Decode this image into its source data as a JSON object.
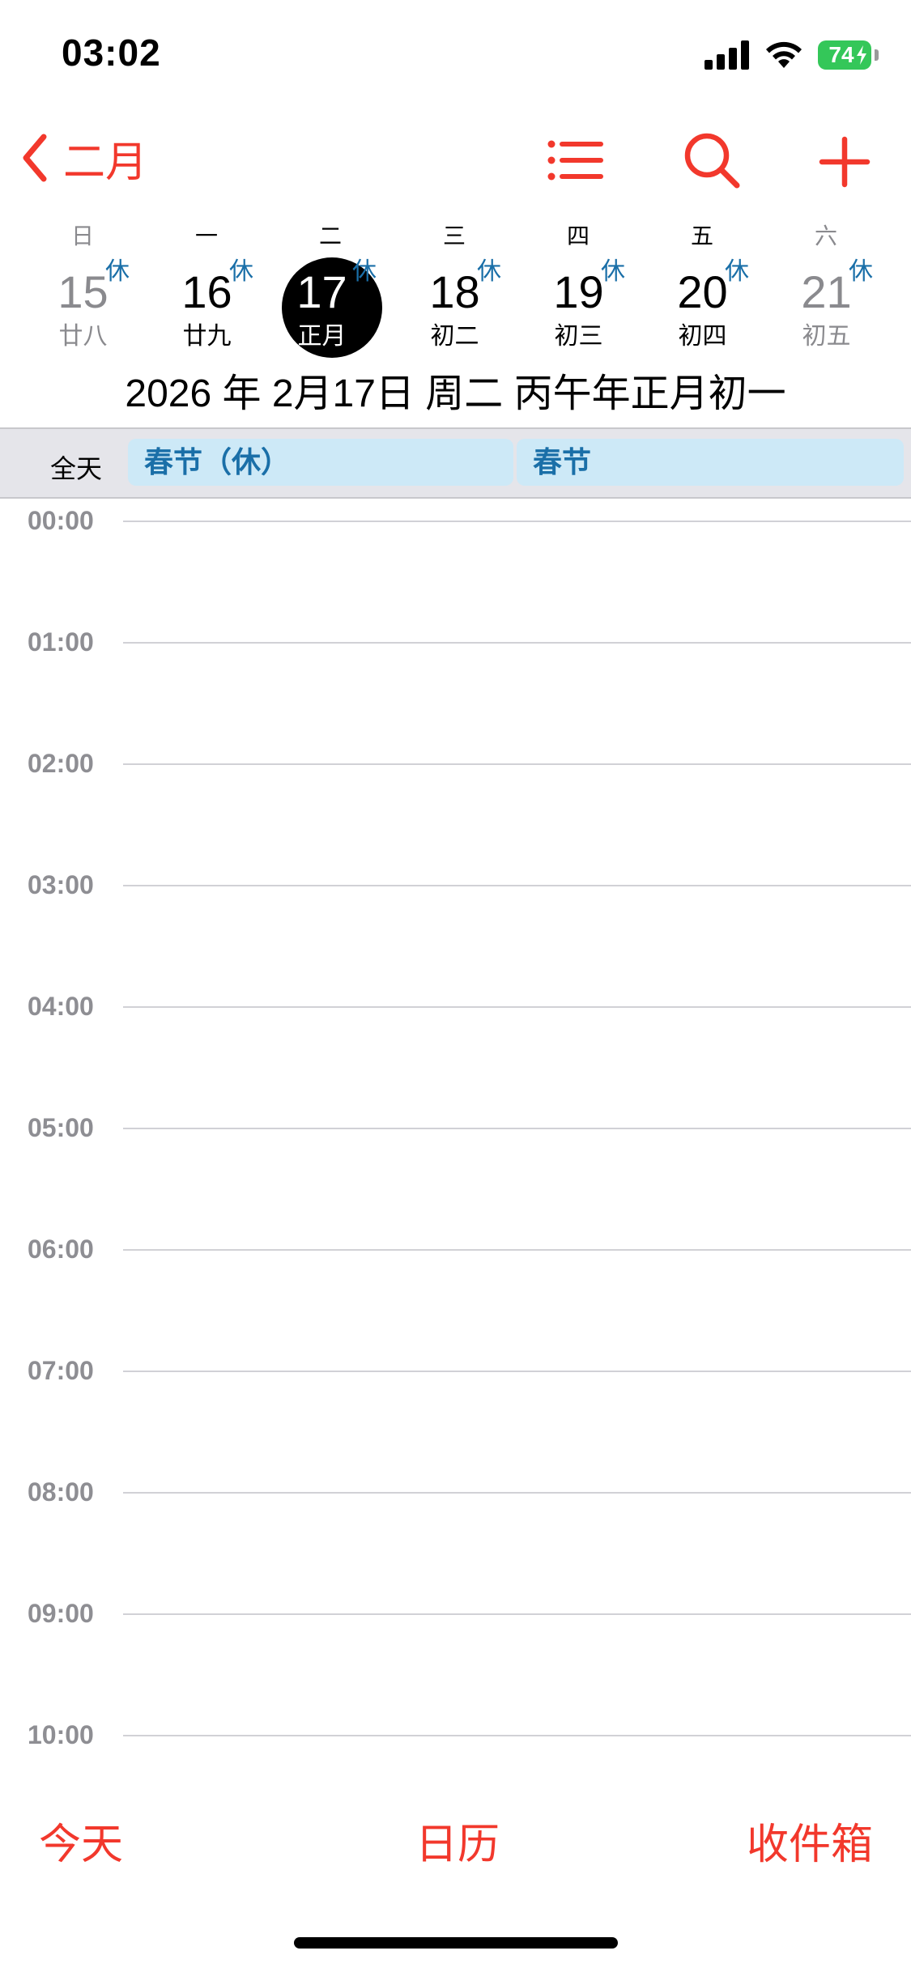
{
  "status_bar": {
    "time": "03:02",
    "battery_level": "74",
    "battery_color": "#34c759"
  },
  "nav": {
    "back_label": "二月",
    "back_icon": "chevron-left-icon",
    "list_icon": "list-icon",
    "search_icon": "search-icon",
    "add_icon": "plus-icon",
    "accent_color": "#f2382c"
  },
  "week": {
    "weekdays": [
      "日",
      "一",
      "二",
      "三",
      "四",
      "五",
      "六"
    ],
    "days": [
      {
        "num": "15",
        "lunar": "廿八",
        "badge": "休"
      },
      {
        "num": "16",
        "lunar": "廿九",
        "badge": "休"
      },
      {
        "num": "17",
        "lunar": "正月",
        "badge": "休"
      },
      {
        "num": "18",
        "lunar": "初二",
        "badge": "休"
      },
      {
        "num": "19",
        "lunar": "初三",
        "badge": "休"
      },
      {
        "num": "20",
        "lunar": "初四",
        "badge": "休"
      },
      {
        "num": "21",
        "lunar": "初五",
        "badge": "休"
      }
    ]
  },
  "date_title": "2026 年 2月17日 周二   丙午年正月初一",
  "all_day": {
    "label": "全天",
    "events": [
      "春节（休）",
      "春节"
    ],
    "event_bg": "#cde9f7",
    "event_text_color": "#1a6fa8"
  },
  "hours": [
    "00:00",
    "01:00",
    "02:00",
    "03:00",
    "04:00",
    "05:00",
    "06:00",
    "07:00",
    "08:00",
    "09:00",
    "10:00"
  ],
  "toolbar": {
    "today": "今天",
    "calendars": "日历",
    "inbox": "收件箱"
  }
}
